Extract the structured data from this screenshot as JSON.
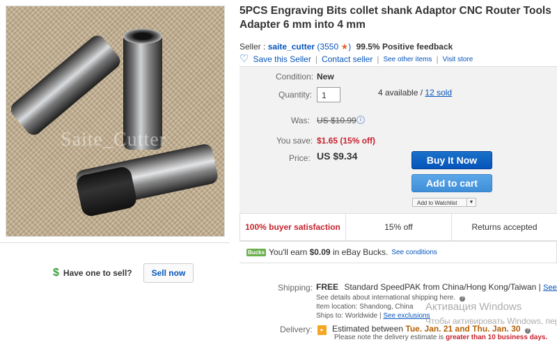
{
  "product": {
    "title": "5PCS Engraving Bits collet shank Adaptor CNC Router Tools Adapter 6 mm into 4 mm",
    "watermark": "Saite_Cutter"
  },
  "seller": {
    "label": "Seller :",
    "name": "saite_cutter",
    "count_prefix": "(",
    "score": "3550",
    "count_suffix": ")",
    "feedback": "99.5% Positive feedback",
    "save_label": "Save this Seller",
    "contact_label": "Contact seller",
    "other_items": "See other items",
    "visit_store": "Visit store"
  },
  "purchase": {
    "condition_label": "Condition:",
    "condition_value": "New",
    "quantity_label": "Quantity:",
    "quantity_value": "1",
    "available": "4 available /",
    "sold": "12 sold",
    "was_label": "Was:",
    "was_value": "US $10.99",
    "save_label": "You save:",
    "save_value": "$1.65 (15% off)",
    "price_label": "Price:",
    "price_value": "US $9.34",
    "buy_now": "Buy It Now",
    "add_to_cart": "Add to cart",
    "add_to_watchlist": "Add to Watchlist"
  },
  "stats": {
    "satisfaction": "100% buyer satisfaction",
    "discount": "15% off",
    "returns": "Returns accepted"
  },
  "bucks": {
    "logo": "Bucks",
    "prefix": "You'll earn ",
    "amount": "$0.09",
    "suffix": " in eBay Bucks.",
    "link": "See conditions"
  },
  "sell": {
    "dollar": "$",
    "prompt": "Have one to sell?",
    "button": "Sell now"
  },
  "shipping": {
    "label": "Shipping:",
    "free": "FREE",
    "method": "Standard SpeedPAK from China/Hong Kong/Taiwan |",
    "details_link": "See details",
    "intl_note": "See details about international shipping here.",
    "location": "Item location:  Shandong, China",
    "ships_to_prefix": "Ships to:  Worldwide  |",
    "exclusions": "See exclusions"
  },
  "delivery": {
    "label": "Delivery:",
    "estimated_prefix": "Estimated between ",
    "dates": "Tue. Jan. 21 and Thu. Jan. 30",
    "note_prefix": "Please note the delivery estimate is ",
    "note_bold": "greater than 10 business days."
  },
  "windows_overlay": {
    "line1": "Активация Windows",
    "line2": "Чтобы активировать Windows, перейдите в раздел \"Параметры\"."
  },
  "colors": {
    "link": "#0654ba",
    "red": "#c7222d",
    "buy_button": "#0654ba",
    "cart_button": "#3f8fd8",
    "star": "#e8642c"
  }
}
